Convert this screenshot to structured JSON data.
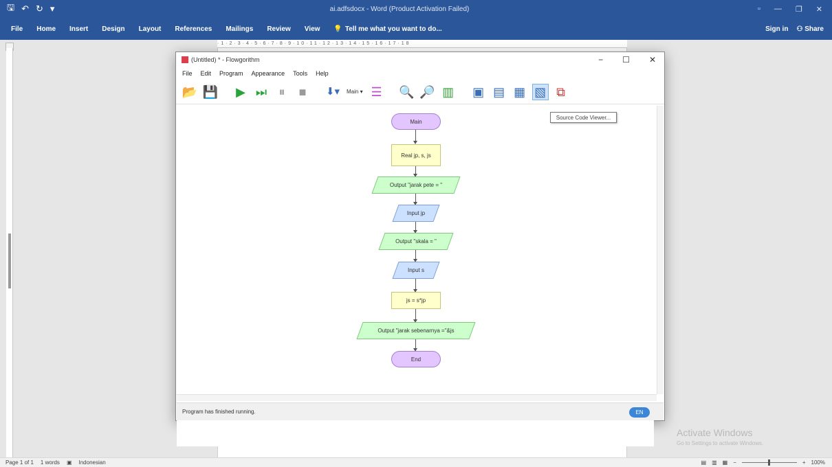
{
  "word": {
    "title": "ai.adfsdocx - Word (Product Activation Failed)",
    "qat": {
      "save": "🖫",
      "undo": "↶",
      "redo": "↻",
      "customize": "▾"
    },
    "window_controls": {
      "ribbon_options": "▫",
      "minimize": "—",
      "restore": "❐",
      "close": "✕"
    },
    "tabs": [
      "File",
      "Home",
      "Insert",
      "Design",
      "Layout",
      "References",
      "Mailings",
      "Review",
      "View"
    ],
    "tell_me": "Tell me what you want to do...",
    "sign_in": "Sign in",
    "share": "Share",
    "ruler_marks": "·1·2·3·4·5·6·7·8·9·10·11·12·13·14·15·16·17·18",
    "status": {
      "page": "Page 1 of 1",
      "words": "1 words",
      "language": "Indonesian"
    },
    "zoom": "100%",
    "activate_title": "Activate Windows",
    "activate_sub": "Go to Settings to activate Windows."
  },
  "flowgorithm": {
    "title": "(Untitled) * - Flowgorithm",
    "window_controls": {
      "minimize": "−",
      "maximize": "☐",
      "close": "✕"
    },
    "menu": [
      "File",
      "Edit",
      "Program",
      "Appearance",
      "Tools",
      "Help"
    ],
    "toolbar": {
      "function_select": "Main"
    },
    "tooltip": "Source Code Viewer...",
    "status_text": "Program has finished running.",
    "language_badge": "EN",
    "flowchart": {
      "start": "Main",
      "declare": "Real jp, s, js",
      "output1": "Output \"jarak pete = \"",
      "input1": "Input jp",
      "output2": "Output \"skala = \"",
      "input2": "Input s",
      "assign": "js = s*jp",
      "output3": "Output \"jarak sebenarnya =\"&js",
      "end": "End"
    }
  },
  "colors": {
    "word_blue": "#2b579a",
    "terminal": "#e3c5ff",
    "process": "#ffffcc",
    "output": "#ccffcc",
    "input": "#cce0ff"
  },
  "icons": {
    "open": "folder-open-icon",
    "save": "save-icon",
    "run": "run-icon",
    "step": "step-icon",
    "pause": "pause-icon",
    "stop": "stop-icon",
    "variables": "variables-icon",
    "add_function": "add-function-icon",
    "zoom_in": "zoom-in-icon",
    "zoom_out": "zoom-out-icon",
    "layout": "layout-icon",
    "console": "console-icon",
    "variable_watch": "variable-watch-icon",
    "source_code_viewer": "source-code-viewer-icon",
    "export": "export-icon"
  }
}
